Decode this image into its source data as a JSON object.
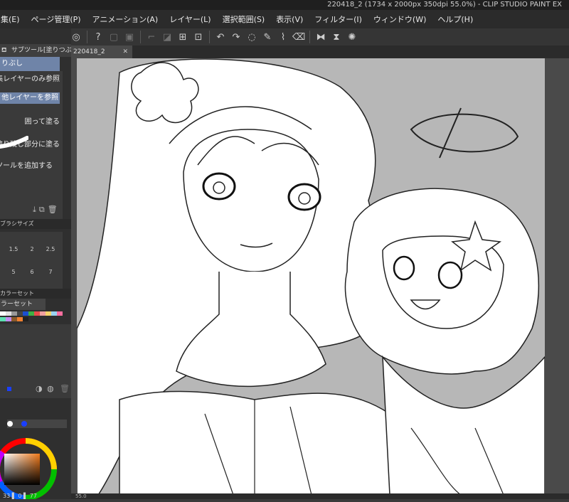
{
  "window": {
    "title": "220418_2 (1734 x 2000px 350dpi 55.0%)  - CLIP STUDIO PAINT EX"
  },
  "menu": [
    "集(E)",
    "ページ管理(P)",
    "アニメーション(A)",
    "レイヤー(L)",
    "選択範囲(S)",
    "表示(V)",
    "フィルター(I)",
    "ウィンドウ(W)",
    "ヘルプ(H)"
  ],
  "subtool": {
    "header": "サブツール[塗りつぶし]",
    "active": "りぶし",
    "options": [
      "集レイヤーのみ参照",
      "他レイヤーを参照",
      "囲って塗る",
      "塗り残し部分に塗る",
      "ブツールを追加する"
    ]
  },
  "brush_size": {
    "header": "ブラシサイズ",
    "values": [
      "1.5",
      "2",
      "2.5",
      "5",
      "6",
      "7"
    ]
  },
  "color_set": {
    "header": "カラーセット",
    "selected": "ラーセット"
  },
  "color_readout": {
    "text": "33 ▌ 0 ▌ 77"
  },
  "document": {
    "tab": "220418_2",
    "zoom": "55.0"
  },
  "colors": {
    "accent": "#6f84a8",
    "canvas_bg": "#b7b7b7"
  }
}
